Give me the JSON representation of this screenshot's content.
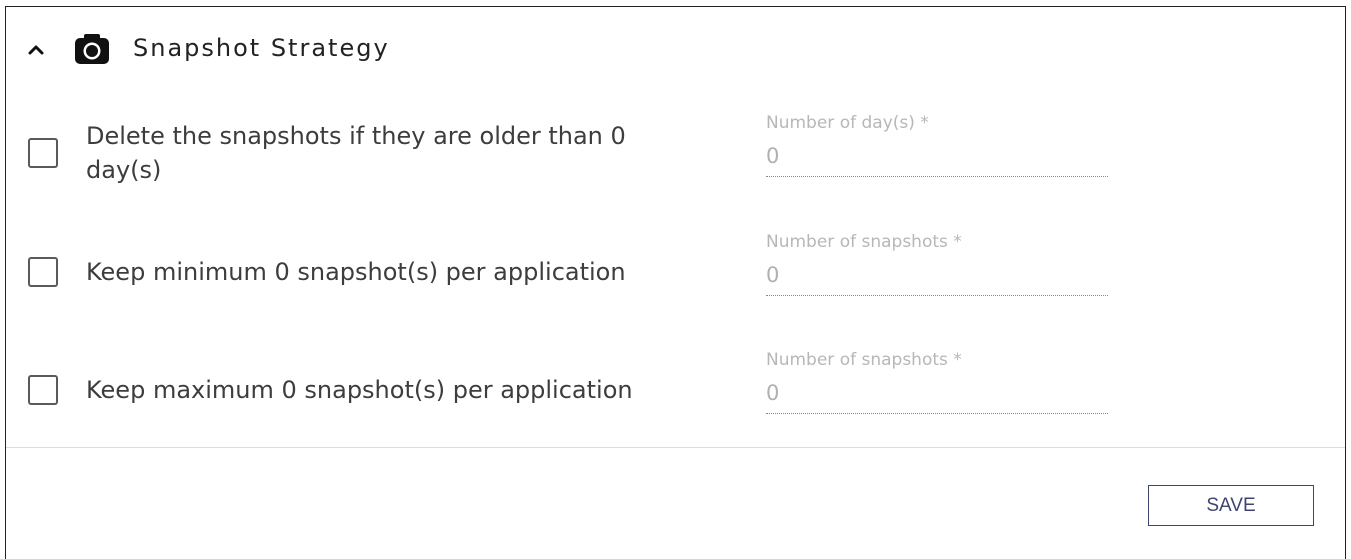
{
  "section": {
    "title": "Snapshot Strategy",
    "expand_icon": "chevron-up-icon",
    "title_icon": "camera-icon"
  },
  "rules": [
    {
      "label": "Delete the snapshots if they are older than 0 day(s)",
      "checked": false,
      "field_label": "Number of day(s) *",
      "field_value": "0"
    },
    {
      "label": "Keep minimum 0 snapshot(s) per application",
      "checked": false,
      "field_label": "Number of snapshots *",
      "field_value": "0"
    },
    {
      "label": "Keep maximum 0 snapshot(s) per application",
      "checked": false,
      "field_label": "Number of snapshots *",
      "field_value": "0"
    }
  ],
  "footer": {
    "save_label": "SAVE"
  },
  "colors": {
    "border": "#222222",
    "text": "#3d3d3d",
    "muted": "#b7b7b7",
    "button": "#3c4670"
  }
}
